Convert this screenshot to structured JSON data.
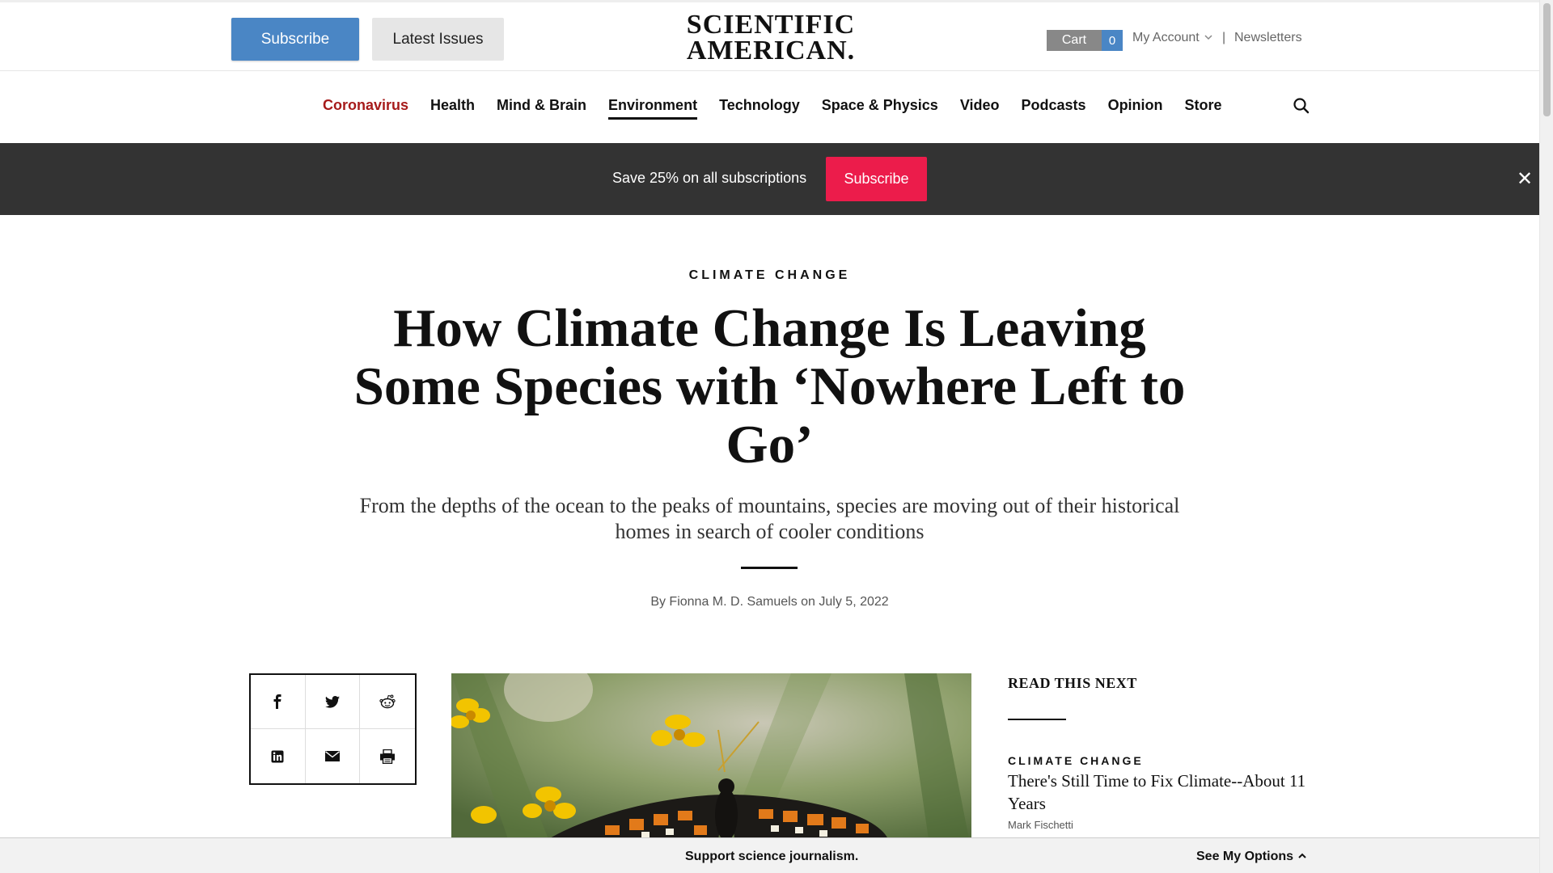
{
  "header": {
    "subscribe_label": "Subscribe",
    "latest_issues_label": "Latest Issues",
    "logo_line1": "SCIENTIFIC",
    "logo_line2": "AMERICAN.",
    "cart_label": "Cart",
    "cart_count": "0",
    "my_account_label": "My Account",
    "separator": "|",
    "newsletters_label": "Newsletters"
  },
  "nav": {
    "items": [
      {
        "label": "Coronavirus"
      },
      {
        "label": "Health"
      },
      {
        "label": "Mind & Brain"
      },
      {
        "label": "Environment"
      },
      {
        "label": "Technology"
      },
      {
        "label": "Space & Physics"
      },
      {
        "label": "Video"
      },
      {
        "label": "Podcasts"
      },
      {
        "label": "Opinion"
      },
      {
        "label": "Store"
      }
    ],
    "active": "Environment",
    "highlight_color": "#a61b1b"
  },
  "promo": {
    "text": "Save 25% on all subscriptions",
    "button_label": "Subscribe",
    "button_color": "#ec1c4b",
    "close_glyph": "✕"
  },
  "article": {
    "kicker": "CLIMATE CHANGE",
    "headline": "How Climate Change Is Leaving Some Species with ‘Nowhere Left to Go’",
    "dek": "From the depths of the ocean to the peaks of mountains, species are moving out of their historical homes in search of cooler conditions",
    "byline": "By Fionna M. D. Samuels on July 5, 2022"
  },
  "share": {
    "icons": [
      "facebook-icon",
      "twitter-icon",
      "reddit-icon",
      "linkedin-icon",
      "email-icon",
      "print-icon"
    ]
  },
  "read_next": {
    "title": "READ THIS NEXT",
    "item": {
      "kicker": "CLIMATE CHANGE",
      "title": "There's Still Time to Fix Climate--About 11 Years",
      "author": "Mark Fischetti"
    }
  },
  "bottom_bar": {
    "text": "Support science journalism.",
    "options_label": "See My Options"
  }
}
